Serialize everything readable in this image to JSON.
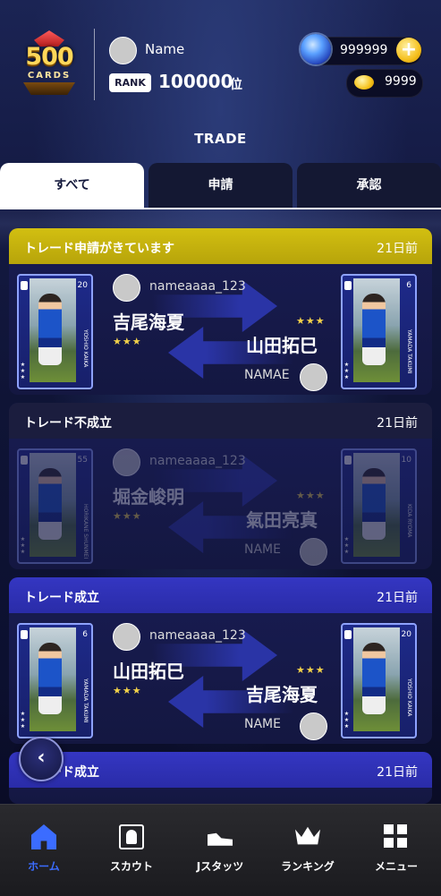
{
  "header": {
    "logo_number": "500",
    "logo_text": "CARDS",
    "user_name": "Name",
    "rank_label": "RANK",
    "rank_value": "100000",
    "rank_unit": "位",
    "gems": "999999",
    "coins": "9999",
    "add_symbol": "+"
  },
  "page_title": "TRADE",
  "tabs": [
    {
      "label": "すべて"
    },
    {
      "label": "申請"
    },
    {
      "label": "承認"
    }
  ],
  "trades": [
    {
      "status": "トレード申請がきています",
      "time": "21日前",
      "left_card": {
        "number": "20",
        "vertical": "YOSHIO KAIKA",
        "stars": "★★★"
      },
      "right_card": {
        "number": "6",
        "vertical": "YAMADA TAKUMI",
        "stars": "★★★"
      },
      "user_top": "nameaaaa_123",
      "player_left": "吉尾海夏",
      "stars_left": "★★★",
      "player_right": "山田拓巳",
      "stars_right": "★★★",
      "user_bottom": "NAMAE"
    },
    {
      "status": "トレード不成立",
      "time": "21日前",
      "left_card": {
        "number": "55",
        "vertical": "HORIKANE SHUNMEI",
        "stars": "★★★"
      },
      "right_card": {
        "number": "10",
        "vertical": "KIDA RYOMA",
        "stars": "★★★"
      },
      "user_top": "nameaaaa_123",
      "player_left": "堀金峻明",
      "stars_left": "★★★",
      "player_right": "氣田亮真",
      "stars_right": "★★★",
      "user_bottom": "NAME"
    },
    {
      "status": "トレード成立",
      "time": "21日前",
      "left_card": {
        "number": "6",
        "vertical": "YAMADA TAKUMI",
        "stars": "★★★"
      },
      "right_card": {
        "number": "20",
        "vertical": "YOSHIO KAIKA",
        "stars": "★★★"
      },
      "user_top": "nameaaaa_123",
      "player_left": "山田拓巳",
      "stars_left": "★★★",
      "player_right": "吉尾海夏",
      "stars_right": "★★★",
      "user_bottom": "NAME"
    },
    {
      "status": "トレード成立",
      "time": "21日前"
    }
  ],
  "back_button": "‹",
  "nav": [
    {
      "label": "ホーム"
    },
    {
      "label": "スカウト"
    },
    {
      "label": "Jスタッツ"
    },
    {
      "label": "ランキング"
    },
    {
      "label": "メニュー"
    }
  ],
  "colors": {
    "pending_header": "#c8b50d",
    "failed_header": "#1b1d3e",
    "success_header": "#3032b8",
    "nav_active": "#3b6cff",
    "stars": "#f3d24a"
  }
}
